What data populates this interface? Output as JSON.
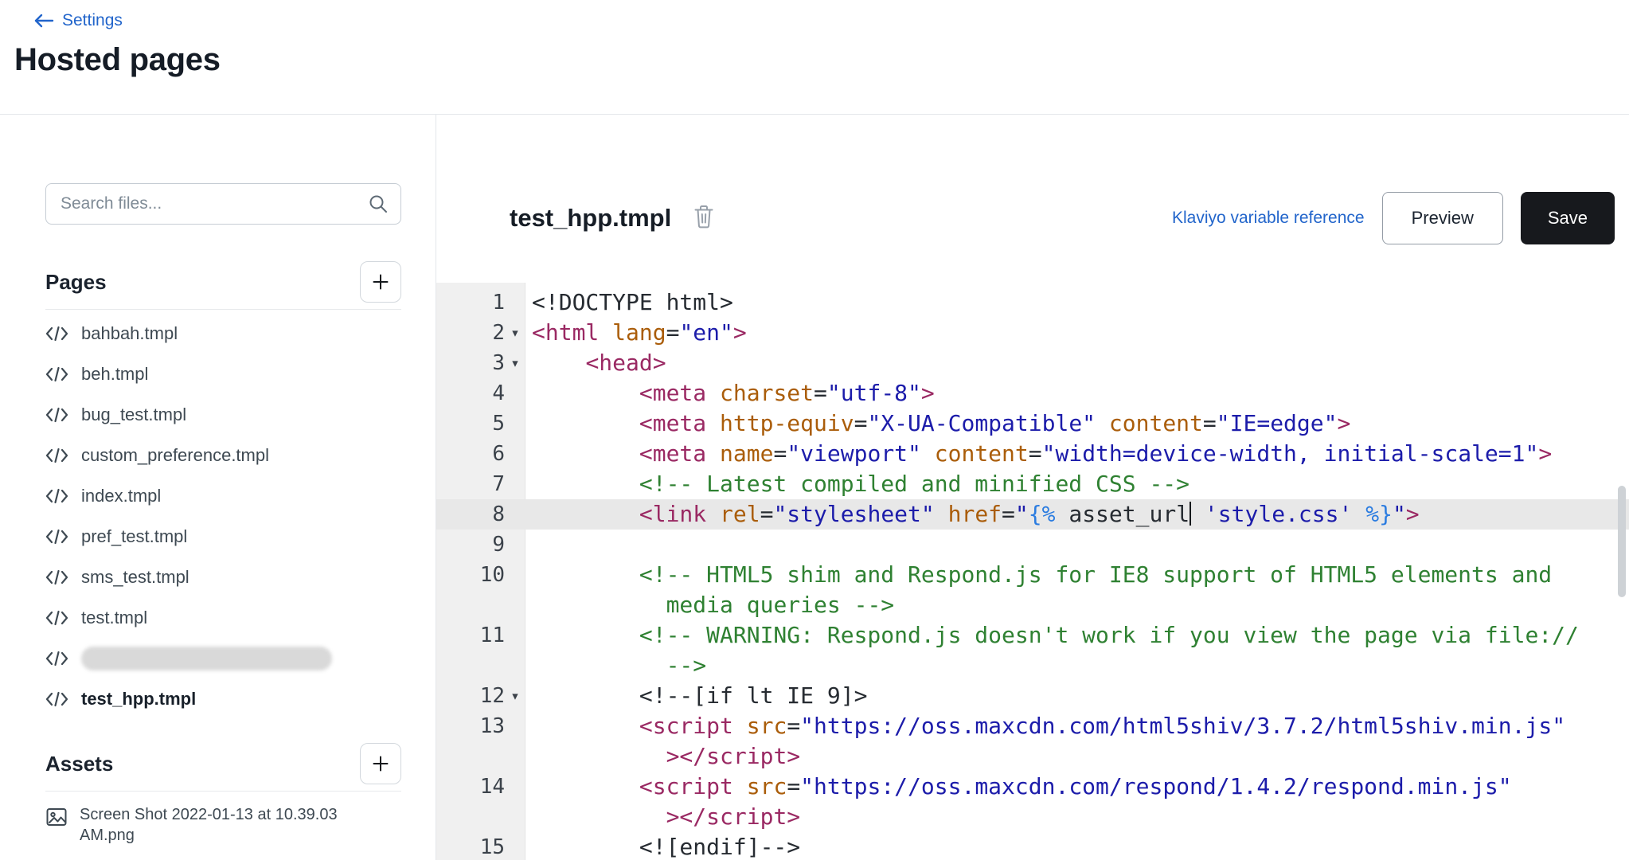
{
  "header": {
    "back_label": "Settings",
    "title": "Hosted pages"
  },
  "sidebar": {
    "search_placeholder": "Search files...",
    "pages_heading": "Pages",
    "assets_heading": "Assets",
    "files": [
      {
        "name": "bahbah.tmpl"
      },
      {
        "name": "beh.tmpl"
      },
      {
        "name": "bug_test.tmpl"
      },
      {
        "name": "custom_preference.tmpl"
      },
      {
        "name": "index.tmpl"
      },
      {
        "name": "pref_test.tmpl"
      },
      {
        "name": "sms_test.tmpl"
      },
      {
        "name": "test.tmpl"
      },
      {
        "name": "",
        "redacted": true
      },
      {
        "name": "test_hpp.tmpl",
        "selected": true
      }
    ],
    "assets": [
      {
        "name": "Screen Shot 2022-01-13 at 10.39.03 AM.png"
      }
    ]
  },
  "main": {
    "file_title": "test_hpp.tmpl",
    "variable_reference_label": "Klaviyo variable reference",
    "preview_label": "Preview",
    "save_label": "Save"
  },
  "icons": {
    "back_arrow": "arrow-left",
    "search": "magnifying-glass",
    "page_file": "code-brackets",
    "asset_file": "image",
    "add": "plus",
    "delete": "trash",
    "fold": "triangle-down",
    "cursor": "text-caret"
  },
  "colors": {
    "link_blue": "#2265cb",
    "save_button_bg": "#17191d",
    "gutter_bg": "#f0f0f0",
    "active_line_bg": "#e8e8e8",
    "syntax": {
      "tag": "#9a2963",
      "attribute": "#aa5d0a",
      "string": "#1c1caa",
      "comment": "#2f8132",
      "template_tag": "#2b7ce0",
      "plain": "#262b31"
    }
  },
  "editor": {
    "active_line": "8",
    "lines": [
      {
        "n": "1",
        "rows": [
          [
            [
              "<!DOCTYPE html>",
              "pln"
            ]
          ]
        ]
      },
      {
        "n": "2",
        "fold": true,
        "rows": [
          [
            [
              "<html",
              "tag"
            ],
            [
              " ",
              "pln"
            ],
            [
              "lang",
              "attr"
            ],
            [
              "=",
              "pln"
            ],
            [
              "\"en\"",
              "str"
            ],
            [
              ">",
              "tag"
            ]
          ]
        ]
      },
      {
        "n": "3",
        "fold": true,
        "rows": [
          [
            [
              "    ",
              "pln"
            ],
            [
              "<head>",
              "tag"
            ]
          ]
        ]
      },
      {
        "n": "4",
        "rows": [
          [
            [
              "        ",
              "pln"
            ],
            [
              "<meta",
              "tag"
            ],
            [
              " ",
              "pln"
            ],
            [
              "charset",
              "attr"
            ],
            [
              "=",
              "pln"
            ],
            [
              "\"utf-8\"",
              "str"
            ],
            [
              ">",
              "tag"
            ]
          ]
        ]
      },
      {
        "n": "5",
        "rows": [
          [
            [
              "        ",
              "pln"
            ],
            [
              "<meta",
              "tag"
            ],
            [
              " ",
              "pln"
            ],
            [
              "http-equiv",
              "attr"
            ],
            [
              "=",
              "pln"
            ],
            [
              "\"X-UA-Compatible\"",
              "str"
            ],
            [
              " ",
              "pln"
            ],
            [
              "content",
              "attr"
            ],
            [
              "=",
              "pln"
            ],
            [
              "\"IE=edge\"",
              "str"
            ],
            [
              ">",
              "tag"
            ]
          ]
        ]
      },
      {
        "n": "6",
        "rows": [
          [
            [
              "        ",
              "pln"
            ],
            [
              "<meta",
              "tag"
            ],
            [
              " ",
              "pln"
            ],
            [
              "name",
              "attr"
            ],
            [
              "=",
              "pln"
            ],
            [
              "\"viewport\"",
              "str"
            ],
            [
              " ",
              "pln"
            ],
            [
              "content",
              "attr"
            ],
            [
              "=",
              "pln"
            ],
            [
              "\"width=device-width, initial-scale=1\"",
              "str"
            ],
            [
              ">",
              "tag"
            ]
          ]
        ]
      },
      {
        "n": "7",
        "rows": [
          [
            [
              "        ",
              "pln"
            ],
            [
              "<!-- Latest compiled and minified CSS -->",
              "cm"
            ]
          ]
        ]
      },
      {
        "n": "8",
        "active": true,
        "rows": [
          [
            [
              "        ",
              "pln"
            ],
            [
              "<link",
              "tag"
            ],
            [
              " ",
              "pln"
            ],
            [
              "rel",
              "attr"
            ],
            [
              "=",
              "pln"
            ],
            [
              "\"stylesheet\"",
              "str"
            ],
            [
              " ",
              "pln"
            ],
            [
              "href",
              "attr"
            ],
            [
              "=",
              "pln"
            ],
            [
              "\"",
              "str"
            ],
            [
              "{%",
              "tpl"
            ],
            [
              " asset_url",
              "pln"
            ],
            [
              "",
              "cursor"
            ],
            [
              " ",
              "pln"
            ],
            [
              "'style.css'",
              "str"
            ],
            [
              " ",
              "pln"
            ],
            [
              "%}",
              "tpl"
            ],
            [
              "\"",
              "str"
            ],
            [
              ">",
              "tag"
            ]
          ]
        ]
      },
      {
        "n": "9",
        "rows": [
          []
        ]
      },
      {
        "n": "10",
        "rows": [
          [
            [
              "        ",
              "pln"
            ],
            [
              "<!-- HTML5 shim and Respond.js for IE8 support of HTML5 elements and",
              "cm"
            ]
          ],
          [
            [
              "          ",
              "pln"
            ],
            [
              "media queries -->",
              "cm"
            ]
          ]
        ]
      },
      {
        "n": "11",
        "rows": [
          [
            [
              "        ",
              "pln"
            ],
            [
              "<!-- WARNING: Respond.js doesn't work if you view the page via file://",
              "cm"
            ]
          ],
          [
            [
              "          ",
              "pln"
            ],
            [
              "-->",
              "cm"
            ]
          ]
        ]
      },
      {
        "n": "12",
        "fold": true,
        "rows": [
          [
            [
              "        ",
              "pln"
            ],
            [
              "<!--[if lt IE 9]>",
              "pln"
            ]
          ]
        ]
      },
      {
        "n": "13",
        "rows": [
          [
            [
              "        ",
              "pln"
            ],
            [
              "<script",
              "tag"
            ],
            [
              " ",
              "pln"
            ],
            [
              "src",
              "attr"
            ],
            [
              "=",
              "pln"
            ],
            [
              "\"https://oss.maxcdn.com/html5shiv/3.7.2/html5shiv.min.js\"",
              "str"
            ]
          ],
          [
            [
              "          ",
              "pln"
            ],
            [
              "></script>",
              "tag"
            ]
          ]
        ]
      },
      {
        "n": "14",
        "rows": [
          [
            [
              "        ",
              "pln"
            ],
            [
              "<script",
              "tag"
            ],
            [
              " ",
              "pln"
            ],
            [
              "src",
              "attr"
            ],
            [
              "=",
              "pln"
            ],
            [
              "\"https://oss.maxcdn.com/respond/1.4.2/respond.min.js\"",
              "str"
            ]
          ],
          [
            [
              "          ",
              "pln"
            ],
            [
              "></script>",
              "tag"
            ]
          ]
        ]
      },
      {
        "n": "15",
        "rows": [
          [
            [
              "        ",
              "pln"
            ],
            [
              "<![endif]-->",
              "pln"
            ]
          ]
        ]
      }
    ]
  }
}
